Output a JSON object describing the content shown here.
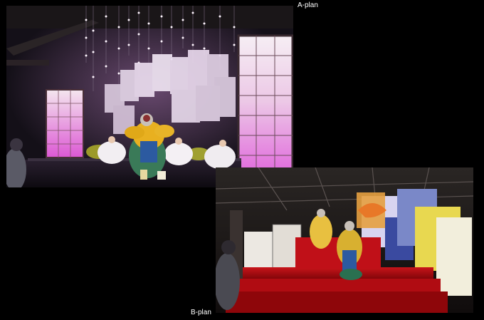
{
  "captions": {
    "a": "A-plan",
    "b": "B-plan"
  },
  "colors": {
    "background": "#000000",
    "caption_text": "#ffffff",
    "panel_pink": "#e36be0",
    "stage_red": "#b3080c",
    "costume_gold": "#e8b020",
    "kimono_yellow": "#e8d850"
  }
}
